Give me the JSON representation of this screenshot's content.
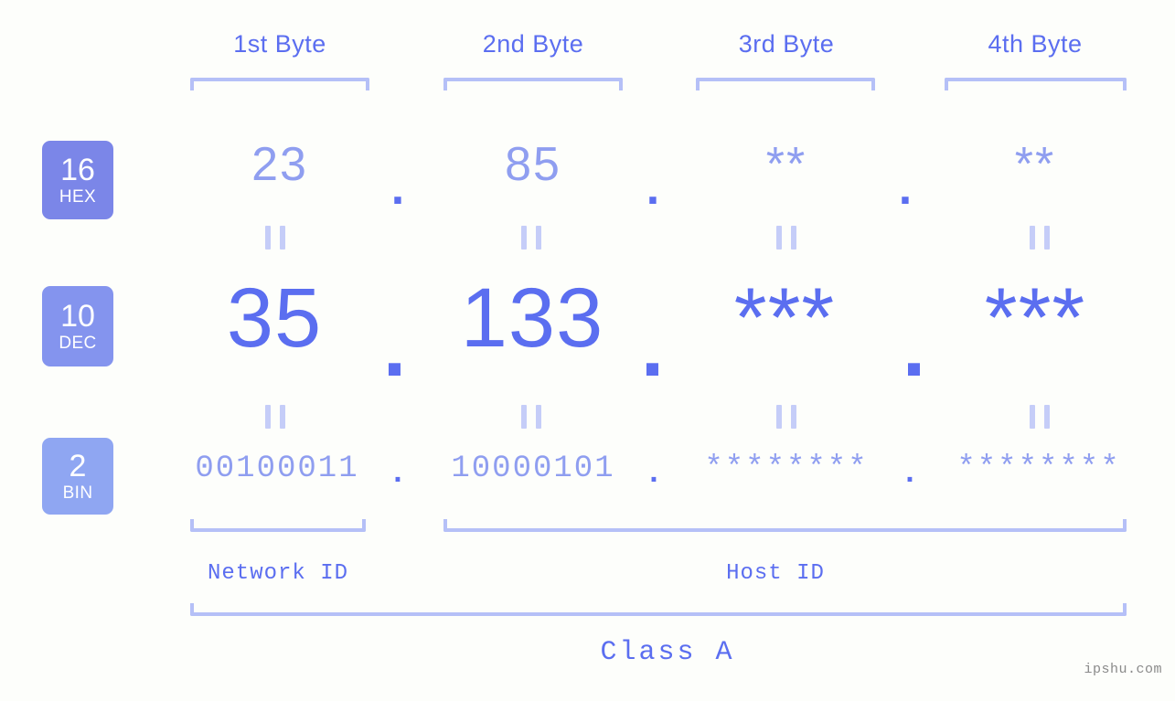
{
  "background_color": "#fdfefb",
  "accent_color": "#5b6ef0",
  "muted_accent_color": "#8f9ef0",
  "bracket_color": "#b5c0f7",
  "headers": {
    "byte1": "1st Byte",
    "byte2": "2nd Byte",
    "byte3": "3rd Byte",
    "byte4": "4th Byte"
  },
  "bases": [
    {
      "number": "16",
      "abbr": "HEX",
      "color": "#7b86e8"
    },
    {
      "number": "10",
      "abbr": "DEC",
      "color": "#8494ee"
    },
    {
      "number": "2",
      "abbr": "BIN",
      "color": "#8fa6f2"
    }
  ],
  "rows": {
    "hex": {
      "label": "HEX",
      "octets": [
        "23",
        "85",
        "**",
        "**"
      ],
      "separator": "."
    },
    "dec": {
      "label": "DEC",
      "octets": [
        "35",
        "133",
        "***",
        "***"
      ],
      "separator": "."
    },
    "bin": {
      "label": "BIN",
      "octets": [
        "00100011",
        "10000101",
        "********",
        "********"
      ],
      "separator": "."
    }
  },
  "sections": {
    "network_id": "Network ID",
    "host_id": "Host ID",
    "class": "Class A"
  },
  "watermark": "ipshu.com"
}
